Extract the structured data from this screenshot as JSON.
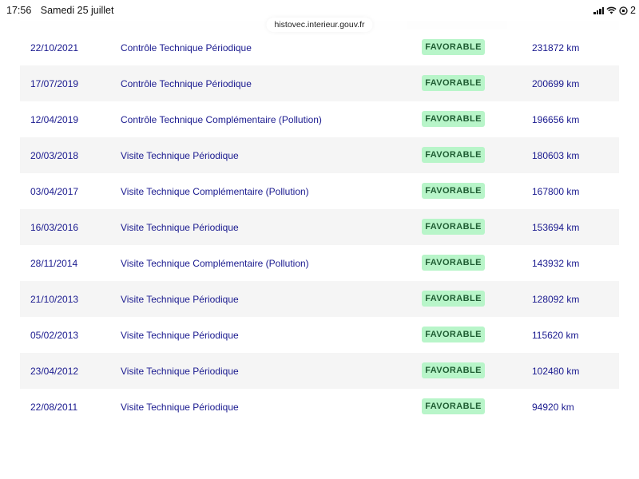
{
  "status_bar": {
    "time": "17:56",
    "date": "Samedi 25 juillet",
    "battery_text": "2"
  },
  "browser": {
    "url": "histovec.interieur.gouv.fr"
  },
  "table": {
    "rows": [
      {
        "date": "",
        "type": "",
        "result": "FAVORABLE",
        "km": ""
      },
      {
        "date": "22/10/2021",
        "type": "Contrôle Technique Périodique",
        "result": "FAVORABLE",
        "km": "231872 km"
      },
      {
        "date": "17/07/2019",
        "type": "Contrôle Technique Périodique",
        "result": "FAVORABLE",
        "km": "200699 km"
      },
      {
        "date": "12/04/2019",
        "type": "Contrôle Technique Complémentaire (Pollution)",
        "result": "FAVORABLE",
        "km": "196656 km"
      },
      {
        "date": "20/03/2018",
        "type": "Visite Technique Périodique",
        "result": "FAVORABLE",
        "km": "180603 km"
      },
      {
        "date": "03/04/2017",
        "type": "Visite Technique Complémentaire (Pollution)",
        "result": "FAVORABLE",
        "km": "167800 km"
      },
      {
        "date": "16/03/2016",
        "type": "Visite Technique Périodique",
        "result": "FAVORABLE",
        "km": "153694 km"
      },
      {
        "date": "28/11/2014",
        "type": "Visite Technique Complémentaire (Pollution)",
        "result": "FAVORABLE",
        "km": "143932 km"
      },
      {
        "date": "21/10/2013",
        "type": "Visite Technique Périodique",
        "result": "FAVORABLE",
        "km": "128092 km"
      },
      {
        "date": "05/02/2013",
        "type": "Visite Technique Périodique",
        "result": "FAVORABLE",
        "km": "115620 km"
      },
      {
        "date": "23/04/2012",
        "type": "Visite Technique Périodique",
        "result": "FAVORABLE",
        "km": "102480 km"
      },
      {
        "date": "22/08/2011",
        "type": "Visite Technique Périodique",
        "result": "FAVORABLE",
        "km": "94920 km"
      }
    ]
  }
}
